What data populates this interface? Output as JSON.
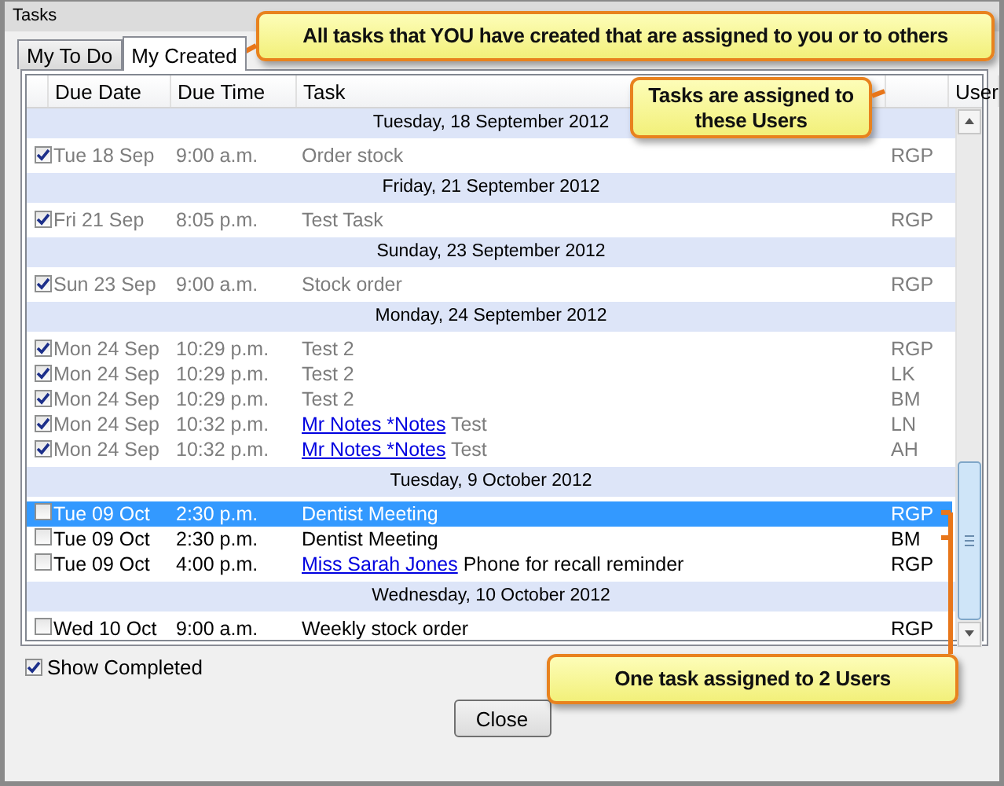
{
  "window": {
    "title": "Tasks"
  },
  "tabs": [
    {
      "label": "My To Do",
      "selected": false
    },
    {
      "label": "My Created",
      "selected": true
    }
  ],
  "table": {
    "columns": [
      "Due Date",
      "Due Time",
      "Task",
      "User"
    ],
    "groups": [
      {
        "heading": "Tuesday, 18 September 2012",
        "rows": [
          {
            "checked": true,
            "selected": false,
            "due_date": "Tue 18 Sep",
            "due_time": "9:00 a.m.",
            "task": "Order stock",
            "user": "RGP"
          }
        ]
      },
      {
        "heading": "Friday, 21 September 2012",
        "rows": [
          {
            "checked": true,
            "selected": false,
            "due_date": "Fri 21 Sep",
            "due_time": "8:05 p.m.",
            "task": "Test Task",
            "user": "RGP"
          }
        ]
      },
      {
        "heading": "Sunday, 23 September 2012",
        "rows": [
          {
            "checked": true,
            "selected": false,
            "due_date": "Sun 23 Sep",
            "due_time": "9:00 a.m.",
            "task": "Stock order",
            "user": "RGP"
          }
        ]
      },
      {
        "heading": "Monday, 24 September 2012",
        "rows": [
          {
            "checked": true,
            "selected": false,
            "due_date": "Mon 24 Sep",
            "due_time": "10:29 p.m.",
            "task": "Test 2",
            "user": "RGP"
          },
          {
            "checked": true,
            "selected": false,
            "due_date": "Mon 24 Sep",
            "due_time": "10:29 p.m.",
            "task": "Test 2",
            "user": "LK"
          },
          {
            "checked": true,
            "selected": false,
            "due_date": "Mon 24 Sep",
            "due_time": "10:29 p.m.",
            "task": "Test 2",
            "user": "BM"
          },
          {
            "checked": true,
            "selected": false,
            "due_date": "Mon 24 Sep",
            "due_time": "10:32 p.m.",
            "contact": "Mr Notes *Notes",
            "task": "Test",
            "user": "LN"
          },
          {
            "checked": true,
            "selected": false,
            "due_date": "Mon 24 Sep",
            "due_time": "10:32 p.m.",
            "contact": "Mr Notes *Notes",
            "task": "Test",
            "user": "AH"
          }
        ]
      },
      {
        "heading": "Tuesday, 9 October 2012",
        "rows": [
          {
            "checked": false,
            "selected": true,
            "due_date": "Tue 09 Oct",
            "due_time": "2:30 p.m.",
            "task": "Dentist Meeting",
            "user": "RGP"
          },
          {
            "checked": false,
            "selected": false,
            "due_date": "Tue 09 Oct",
            "due_time": "2:30 p.m.",
            "task": "Dentist Meeting",
            "user": "BM"
          },
          {
            "checked": false,
            "selected": false,
            "due_date": "Tue 09 Oct",
            "due_time": "4:00 p.m.",
            "contact": "Miss Sarah Jones",
            "task": "Phone for recall reminder",
            "user": "RGP"
          }
        ]
      },
      {
        "heading": "Wednesday, 10 October 2012",
        "rows": [
          {
            "checked": false,
            "selected": false,
            "due_date": "Wed 10 Oct",
            "due_time": "9:00 a.m.",
            "task": "Weekly stock order",
            "user": "RGP"
          }
        ]
      }
    ]
  },
  "show_completed": {
    "label": "Show Completed",
    "checked": true
  },
  "buttons": [
    "Close"
  ],
  "callouts": [
    {
      "text": "All tasks that YOU have created that are assigned to you or to others"
    },
    {
      "text": "Tasks are assigned to these Users"
    },
    {
      "text": "One task assigned to 2 Users"
    }
  ]
}
